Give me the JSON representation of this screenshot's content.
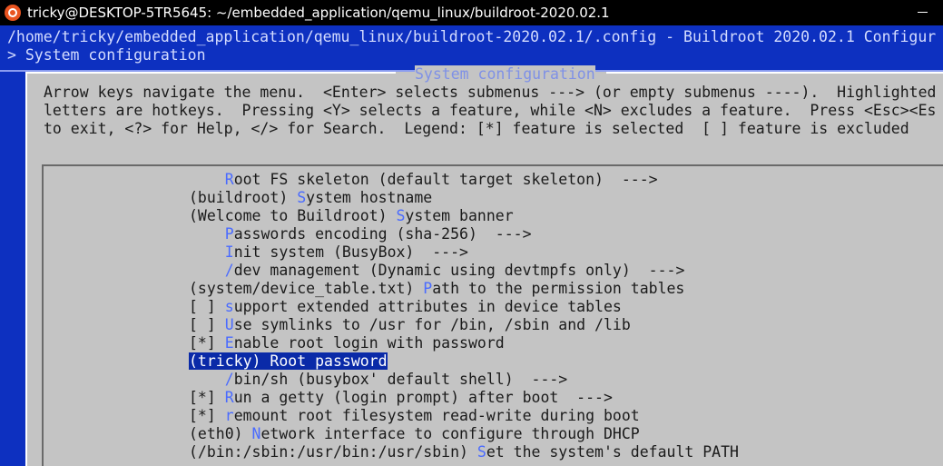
{
  "window": {
    "title": "tricky@DESKTOP-5TR5645: ~/embedded_application/qemu_linux/buildroot-2020.02.1"
  },
  "terminal": {
    "config_path": "/home/tricky/embedded_application/qemu_linux/buildroot-2020.02.1/.config - Buildroot 2020.02.1 Configur",
    "breadcrumb": "> System configuration"
  },
  "dialog": {
    "title": "System configuration",
    "help_lines": [
      "Arrow keys navigate the menu.  <Enter> selects submenus ---> (or empty submenus ----).  Highlighted",
      "letters are hotkeys.  Pressing <Y> selects a feature, while <N> excludes a feature.  Press <Esc><Es",
      "to exit, <?> for Help, </> for Search.  Legend: [*] feature is selected  [ ] feature is excluded"
    ]
  },
  "menu": {
    "selected_index": 10,
    "items": [
      {
        "prefix": "    ",
        "hot": "R",
        "text": "oot FS skeleton (default target skeleton)  --->"
      },
      {
        "prefix": "(buildroot) ",
        "hot": "S",
        "text": "ystem hostname"
      },
      {
        "prefix": "(Welcome to Buildroot) ",
        "hot": "S",
        "text": "ystem banner"
      },
      {
        "prefix": "    ",
        "hot": "P",
        "text": "asswords encoding (sha-256)  --->"
      },
      {
        "prefix": "    ",
        "hot": "I",
        "text": "nit system (BusyBox)  --->"
      },
      {
        "prefix": "    ",
        "hot": "/",
        "text": "dev management (Dynamic using devtmpfs only)  --->"
      },
      {
        "prefix": "(system/device_table.txt) ",
        "hot": "P",
        "text": "ath to the permission tables"
      },
      {
        "prefix": "[ ] ",
        "hot": "s",
        "text": "upport extended attributes in device tables"
      },
      {
        "prefix": "[ ] ",
        "hot": "U",
        "text": "se symlinks to /usr for /bin, /sbin and /lib"
      },
      {
        "prefix": "[*] ",
        "hot": "E",
        "text": "nable root login with password"
      },
      {
        "prefix": "(tricky) ",
        "hot": "R",
        "text": "oot password"
      },
      {
        "prefix": "    ",
        "hot": "/",
        "text": "bin/sh (busybox' default shell)  --->"
      },
      {
        "prefix": "[*] ",
        "hot": "R",
        "text": "un a getty (login prompt) after boot  --->"
      },
      {
        "prefix": "[*] ",
        "hot": "r",
        "text": "emount root filesystem read-write during boot"
      },
      {
        "prefix": "(eth0) ",
        "hot": "N",
        "text": "etwork interface to configure through DHCP"
      },
      {
        "prefix": "(/bin:/sbin:/usr/bin:/usr/sbin) ",
        "hot": "S",
        "text": "et the system's default PATH"
      }
    ]
  },
  "colors": {
    "terminal_bg": "#0d30c0",
    "dialog_bg": "#c4c4c4",
    "hotkey": "#4a6bff",
    "selection_bg": "#0a2aa8",
    "titlebar_bg": "#000000",
    "ubuntu_orange": "#e95420"
  },
  "icons": {
    "app": "ubuntu-logo-icon",
    "minimize": "minimize-icon"
  }
}
